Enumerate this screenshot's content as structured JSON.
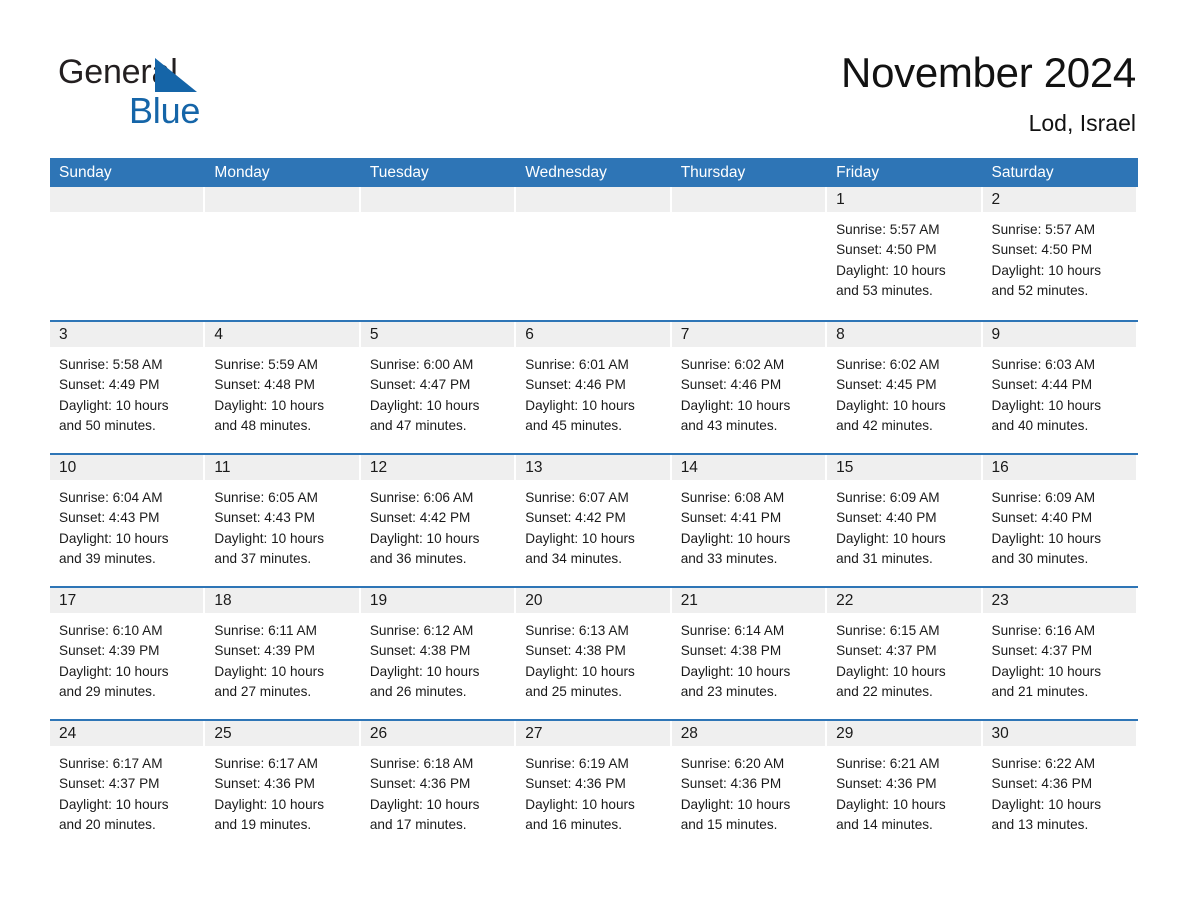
{
  "brand": {
    "name_part1": "General",
    "name_part2": "Blue",
    "triangle_color": "#1565a8"
  },
  "header": {
    "title": "November 2024",
    "subtitle": "Lod, Israel",
    "header_bg_color": "#2e75b6",
    "day_band_color": "#efefef"
  },
  "weekdays": [
    {
      "label": "Sunday"
    },
    {
      "label": "Monday"
    },
    {
      "label": "Tuesday"
    },
    {
      "label": "Wednesday"
    },
    {
      "label": "Thursday"
    },
    {
      "label": "Friday"
    },
    {
      "label": "Saturday"
    }
  ],
  "weeks": [
    [
      {
        "day": "",
        "sunrise": "",
        "sunset": "",
        "daylight1": "",
        "daylight2": "",
        "empty": true
      },
      {
        "day": "",
        "sunrise": "",
        "sunset": "",
        "daylight1": "",
        "daylight2": "",
        "empty": true
      },
      {
        "day": "",
        "sunrise": "",
        "sunset": "",
        "daylight1": "",
        "daylight2": "",
        "empty": true
      },
      {
        "day": "",
        "sunrise": "",
        "sunset": "",
        "daylight1": "",
        "daylight2": "",
        "empty": true
      },
      {
        "day": "",
        "sunrise": "",
        "sunset": "",
        "daylight1": "",
        "daylight2": "",
        "empty": true
      },
      {
        "day": "1",
        "sunrise": "Sunrise: 5:57 AM",
        "sunset": "Sunset: 4:50 PM",
        "daylight1": "Daylight: 10 hours",
        "daylight2": "and 53 minutes."
      },
      {
        "day": "2",
        "sunrise": "Sunrise: 5:57 AM",
        "sunset": "Sunset: 4:50 PM",
        "daylight1": "Daylight: 10 hours",
        "daylight2": "and 52 minutes."
      }
    ],
    [
      {
        "day": "3",
        "sunrise": "Sunrise: 5:58 AM",
        "sunset": "Sunset: 4:49 PM",
        "daylight1": "Daylight: 10 hours",
        "daylight2": "and 50 minutes."
      },
      {
        "day": "4",
        "sunrise": "Sunrise: 5:59 AM",
        "sunset": "Sunset: 4:48 PM",
        "daylight1": "Daylight: 10 hours",
        "daylight2": "and 48 minutes."
      },
      {
        "day": "5",
        "sunrise": "Sunrise: 6:00 AM",
        "sunset": "Sunset: 4:47 PM",
        "daylight1": "Daylight: 10 hours",
        "daylight2": "and 47 minutes."
      },
      {
        "day": "6",
        "sunrise": "Sunrise: 6:01 AM",
        "sunset": "Sunset: 4:46 PM",
        "daylight1": "Daylight: 10 hours",
        "daylight2": "and 45 minutes."
      },
      {
        "day": "7",
        "sunrise": "Sunrise: 6:02 AM",
        "sunset": "Sunset: 4:46 PM",
        "daylight1": "Daylight: 10 hours",
        "daylight2": "and 43 minutes."
      },
      {
        "day": "8",
        "sunrise": "Sunrise: 6:02 AM",
        "sunset": "Sunset: 4:45 PM",
        "daylight1": "Daylight: 10 hours",
        "daylight2": "and 42 minutes."
      },
      {
        "day": "9",
        "sunrise": "Sunrise: 6:03 AM",
        "sunset": "Sunset: 4:44 PM",
        "daylight1": "Daylight: 10 hours",
        "daylight2": "and 40 minutes."
      }
    ],
    [
      {
        "day": "10",
        "sunrise": "Sunrise: 6:04 AM",
        "sunset": "Sunset: 4:43 PM",
        "daylight1": "Daylight: 10 hours",
        "daylight2": "and 39 minutes."
      },
      {
        "day": "11",
        "sunrise": "Sunrise: 6:05 AM",
        "sunset": "Sunset: 4:43 PM",
        "daylight1": "Daylight: 10 hours",
        "daylight2": "and 37 minutes."
      },
      {
        "day": "12",
        "sunrise": "Sunrise: 6:06 AM",
        "sunset": "Sunset: 4:42 PM",
        "daylight1": "Daylight: 10 hours",
        "daylight2": "and 36 minutes."
      },
      {
        "day": "13",
        "sunrise": "Sunrise: 6:07 AM",
        "sunset": "Sunset: 4:42 PM",
        "daylight1": "Daylight: 10 hours",
        "daylight2": "and 34 minutes."
      },
      {
        "day": "14",
        "sunrise": "Sunrise: 6:08 AM",
        "sunset": "Sunset: 4:41 PM",
        "daylight1": "Daylight: 10 hours",
        "daylight2": "and 33 minutes."
      },
      {
        "day": "15",
        "sunrise": "Sunrise: 6:09 AM",
        "sunset": "Sunset: 4:40 PM",
        "daylight1": "Daylight: 10 hours",
        "daylight2": "and 31 minutes."
      },
      {
        "day": "16",
        "sunrise": "Sunrise: 6:09 AM",
        "sunset": "Sunset: 4:40 PM",
        "daylight1": "Daylight: 10 hours",
        "daylight2": "and 30 minutes."
      }
    ],
    [
      {
        "day": "17",
        "sunrise": "Sunrise: 6:10 AM",
        "sunset": "Sunset: 4:39 PM",
        "daylight1": "Daylight: 10 hours",
        "daylight2": "and 29 minutes."
      },
      {
        "day": "18",
        "sunrise": "Sunrise: 6:11 AM",
        "sunset": "Sunset: 4:39 PM",
        "daylight1": "Daylight: 10 hours",
        "daylight2": "and 27 minutes."
      },
      {
        "day": "19",
        "sunrise": "Sunrise: 6:12 AM",
        "sunset": "Sunset: 4:38 PM",
        "daylight1": "Daylight: 10 hours",
        "daylight2": "and 26 minutes."
      },
      {
        "day": "20",
        "sunrise": "Sunrise: 6:13 AM",
        "sunset": "Sunset: 4:38 PM",
        "daylight1": "Daylight: 10 hours",
        "daylight2": "and 25 minutes."
      },
      {
        "day": "21",
        "sunrise": "Sunrise: 6:14 AM",
        "sunset": "Sunset: 4:38 PM",
        "daylight1": "Daylight: 10 hours",
        "daylight2": "and 23 minutes."
      },
      {
        "day": "22",
        "sunrise": "Sunrise: 6:15 AM",
        "sunset": "Sunset: 4:37 PM",
        "daylight1": "Daylight: 10 hours",
        "daylight2": "and 22 minutes."
      },
      {
        "day": "23",
        "sunrise": "Sunrise: 6:16 AM",
        "sunset": "Sunset: 4:37 PM",
        "daylight1": "Daylight: 10 hours",
        "daylight2": "and 21 minutes."
      }
    ],
    [
      {
        "day": "24",
        "sunrise": "Sunrise: 6:17 AM",
        "sunset": "Sunset: 4:37 PM",
        "daylight1": "Daylight: 10 hours",
        "daylight2": "and 20 minutes."
      },
      {
        "day": "25",
        "sunrise": "Sunrise: 6:17 AM",
        "sunset": "Sunset: 4:36 PM",
        "daylight1": "Daylight: 10 hours",
        "daylight2": "and 19 minutes."
      },
      {
        "day": "26",
        "sunrise": "Sunrise: 6:18 AM",
        "sunset": "Sunset: 4:36 PM",
        "daylight1": "Daylight: 10 hours",
        "daylight2": "and 17 minutes."
      },
      {
        "day": "27",
        "sunrise": "Sunrise: 6:19 AM",
        "sunset": "Sunset: 4:36 PM",
        "daylight1": "Daylight: 10 hours",
        "daylight2": "and 16 minutes."
      },
      {
        "day": "28",
        "sunrise": "Sunrise: 6:20 AM",
        "sunset": "Sunset: 4:36 PM",
        "daylight1": "Daylight: 10 hours",
        "daylight2": "and 15 minutes."
      },
      {
        "day": "29",
        "sunrise": "Sunrise: 6:21 AM",
        "sunset": "Sunset: 4:36 PM",
        "daylight1": "Daylight: 10 hours",
        "daylight2": "and 14 minutes."
      },
      {
        "day": "30",
        "sunrise": "Sunrise: 6:22 AM",
        "sunset": "Sunset: 4:36 PM",
        "daylight1": "Daylight: 10 hours",
        "daylight2": "and 13 minutes."
      }
    ]
  ]
}
